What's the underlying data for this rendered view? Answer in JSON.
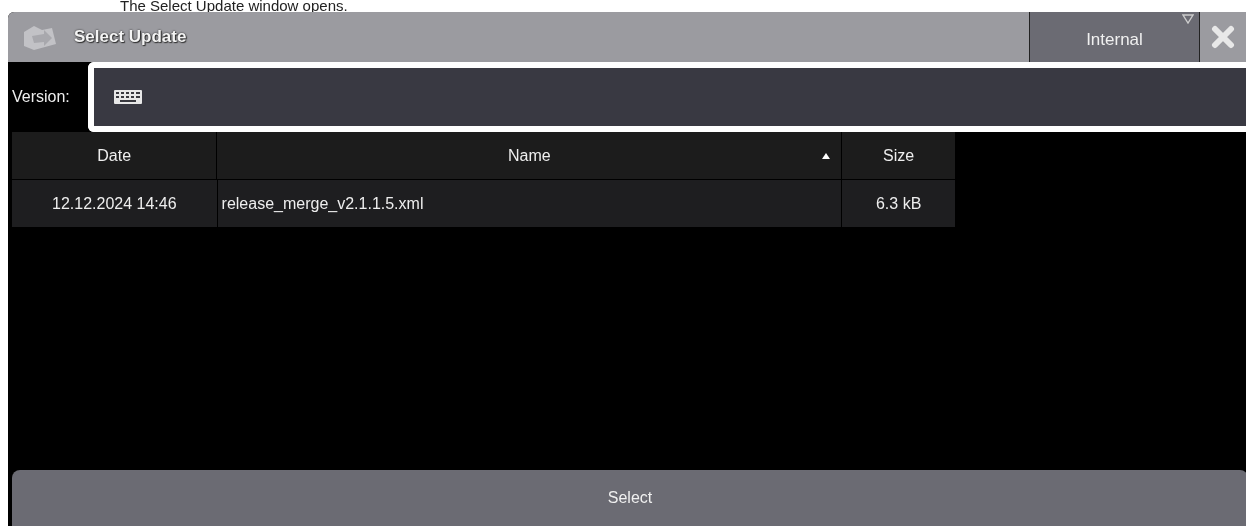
{
  "caption": "The Select Update window opens.",
  "window": {
    "title": "Select Update",
    "location_dropdown": "Internal"
  },
  "version_field": {
    "label": "Version:"
  },
  "table": {
    "columns": [
      {
        "label": "Date",
        "sorted": false
      },
      {
        "label": "Name",
        "sorted": true
      },
      {
        "label": "Size",
        "sorted": false
      }
    ],
    "rows": [
      {
        "cells": [
          "12.12.2024 14:46",
          "release_merge_v2.1.1.5.xml",
          "6.3 kB"
        ]
      }
    ]
  },
  "buttons": [
    "Select"
  ]
}
